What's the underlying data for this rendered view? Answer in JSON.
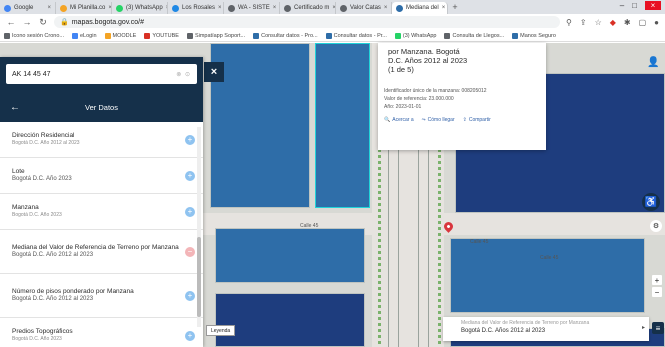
{
  "tabs": [
    {
      "title": "Google",
      "color": "#4285f4",
      "active": false
    },
    {
      "title": "Mi Planilla.co",
      "color": "#f4a425",
      "active": false
    },
    {
      "title": "(3) WhatsApp",
      "color": "#25d366",
      "active": false
    },
    {
      "title": "Los Rosales",
      "color": "#1e88e5",
      "active": false
    },
    {
      "title": "WA - SISTE",
      "color": "#5f6368",
      "active": false
    },
    {
      "title": "Certificado m",
      "color": "#5f6368",
      "active": false
    },
    {
      "title": "Valor Catas",
      "color": "#5f6368",
      "active": false
    },
    {
      "title": "Mediana del",
      "color": "#2e6da8",
      "active": true
    },
    {
      "title": "+",
      "color": "",
      "active": false
    }
  ],
  "address": {
    "url": "mapas.bogota.gov.co/#"
  },
  "bookmarks": [
    {
      "label": "Icono sesión Crono...",
      "color": "#5f6368"
    },
    {
      "label": "eLogin",
      "color": "#4285f4"
    },
    {
      "label": "MOODLE",
      "color": "#f4a425"
    },
    {
      "label": "YOUTUBE",
      "color": "#d93025"
    },
    {
      "label": "Simpatíapp Soport...",
      "color": "#5f6368"
    },
    {
      "label": "Consultar datos - Pro...",
      "color": "#2e6da8"
    },
    {
      "label": "Consultar datos - Pr...",
      "color": "#2e6da8"
    },
    {
      "label": "(3) WhatsApp",
      "color": "#25d366"
    },
    {
      "label": "Consulta de Llegos...",
      "color": "#5f6368"
    },
    {
      "label": "Manos Seguro",
      "color": "#2e6da8"
    }
  ],
  "search": {
    "value": "AK 14 45 47"
  },
  "panel": {
    "title": "Ver Datos"
  },
  "layers": [
    {
      "name": "Dirección Residencial",
      "sub": "Bogotá D.C. Año 2012 al 2023",
      "state": "add"
    },
    {
      "name": "Lote",
      "sub": "Bogotá D.C. Año 2023",
      "state": "add",
      "big": true
    },
    {
      "name": "Manzana",
      "sub": "Bogotá D.C. Año 2023",
      "state": "add"
    },
    {
      "name": "Mediana del Valor de Referencia de Terreno por Manzana",
      "sub": "Bogotá D.C. Año 2012 al 2023",
      "state": "remove",
      "big": true
    },
    {
      "name": "Número de pisos ponderado por Manzana",
      "sub": "Bogotá D.C. Año 2012 al 2023",
      "state": "add",
      "big": true
    },
    {
      "name": "Predios Topográficos",
      "sub": "Bogotá D.C. Año 2023",
      "state": "add"
    }
  ],
  "popup": {
    "title1": "por Manzana. Bogotá",
    "title2": "D.C. Años 2012 al 2023",
    "title3": "(1 de 5)",
    "meta1": "Identificador único de la manzana: 008205012",
    "meta2": "Valor de referencia: 23.000.000",
    "meta3": "Año: 2023-01-01",
    "actions": [
      "Acercar a",
      "Cómo llegar",
      "Compartir"
    ]
  },
  "streets": [
    "Calle 45",
    "Calle 45",
    "Calle 45"
  ],
  "legend": {
    "label": "Leyenda"
  },
  "bottom_card": {
    "line1": "Mediana del Valor de Referencia de Terreno por Manzana",
    "line2": "Bogotá D.C. Años 2012 al 2023"
  },
  "colors": {
    "dark_block": "#1e3d7e",
    "light_block": "#2e6da8",
    "selected_outline": "#20d4d9",
    "header": "#15304a"
  }
}
